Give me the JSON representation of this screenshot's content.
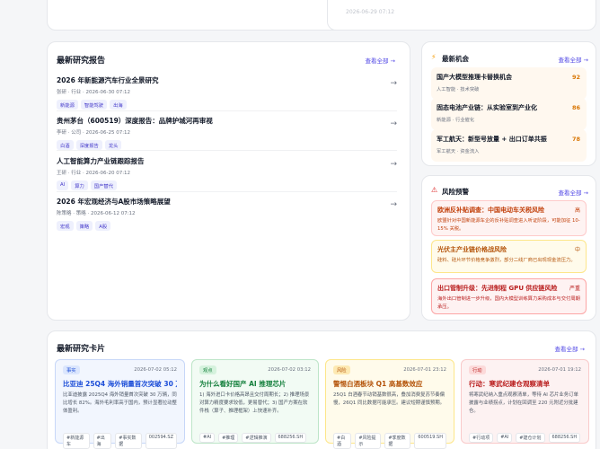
{
  "top_card_right": {
    "timestamp": "2026-06-29 07:12"
  },
  "latest_reports": {
    "title": "最新研究报告",
    "view_all": "查看全部 →",
    "items": [
      {
        "title": "2026 年新能源汽车行业全景研究",
        "meta": "张研 · 行业 · 2026-06-30 07:12",
        "tags": [
          "新能源",
          "智能驾驶",
          "出海"
        ]
      },
      {
        "title": "贵州茅台（600519）深度报告：品牌护城河再审视",
        "meta": "李研 · 公司 · 2026-06-25 07:12",
        "tags": [
          "白酒",
          "深度报告",
          "龙头"
        ]
      },
      {
        "title": "人工智能算力产业链跟踪报告",
        "meta": "王研 · 行业 · 2026-06-20 07:12",
        "tags": [
          "AI",
          "算力",
          "国产替代"
        ]
      },
      {
        "title": "2026 年宏观经济与A股市场策略展望",
        "meta": "陈策略 · 策略 · 2026-06-12 07:12",
        "tags": [
          "宏观",
          "策略",
          "A股"
        ]
      }
    ]
  },
  "opportunities": {
    "title": "最新机会",
    "view_all": "查看全部 →",
    "items": [
      {
        "title": "国产大模型推理卡替换机会",
        "meta": "人工智能 · 技术突破",
        "score": "92"
      },
      {
        "title": "固态电池产业链：从实验室到产业化",
        "meta": "新能源 · 行业催化",
        "score": "86"
      },
      {
        "title": "军工航天：新型号放量 + 出口订单共振",
        "meta": "军工航天 · 资金流入",
        "score": "78"
      }
    ]
  },
  "risks": {
    "title": "风险预警",
    "view_all": "查看全部 →",
    "items": [
      {
        "title": "欧洲反补贴调查：中国电动车关税风险",
        "desc": "欧盟针对中国新能源车企的反补贴调查进入听证阶段，可能加征 10-15% 关税。",
        "level": "高"
      },
      {
        "title": "光伏主产业链价格战风险",
        "desc": "硅料、硅片环节价格竞争激烈，部分二线厂商已出现现金流压力。",
        "level": "中"
      },
      {
        "title": "出口管制升级：先进制程 GPU 供应链风险",
        "desc": "海外出口管制进一步升级，国内大模型训练算力采购成本与交付周期承压。",
        "level": "严重"
      }
    ]
  },
  "research_cards": {
    "title": "最新研究卡片",
    "view_all": "查看全部 →",
    "items": [
      {
        "type": "事实",
        "date": "2026-07-02 05:12",
        "title": "比亚迪 25Q4 海外销量首次突破 30 万辆",
        "desc": "比亚迪披露 2025Q4 海外销量首次突破 30 万辆，同比增长 82%。海外毛利率高于国内，预计显著拉动整体盈利。",
        "tags": [
          "#新能源车",
          "#出海",
          "#事实数据",
          "002594.SZ"
        ]
      },
      {
        "type": "观点",
        "date": "2026-07-02 03:12",
        "title": "为什么看好国产 AI 推理芯片",
        "desc": "1) 海外进口卡价格高昂且交付周期长；2) 推理场景对算力精度要求较低，更易替代；3) 国产方案在软件栈（算子、推理框架）上快速补齐。",
        "tags": [
          "#AI",
          "#推理",
          "#逻辑推演",
          "688256.SH"
        ]
      },
      {
        "type": "风险",
        "date": "2026-07-01 23:12",
        "title": "警惕白酒板块 Q1 高基数效应",
        "desc": "25Q1 白酒春节动销基数很高，叠加消费复苏节奏偏慢，26Q1 同比数据可能承压。建议短期谨慎预期。",
        "tags": [
          "#白酒",
          "#风险提示",
          "#季度数据",
          "600519.SH"
        ]
      },
      {
        "type": "行动",
        "date": "2026-07-01 19:12",
        "title": "行动：寒武纪建仓观察清单",
        "desc": "将寒武纪纳入重点观察清单，等待 AI 芯片业务订单披露与业绩拐点，计划在回调至 220 元附近分批建仓。",
        "tags": [
          "#行动项",
          "#AI",
          "#建仓计划",
          "688256.SH"
        ]
      }
    ]
  },
  "colors": {
    "accent": "#4f46e5",
    "opportunity_bg": "#fff8ef",
    "score": "#d97706"
  }
}
